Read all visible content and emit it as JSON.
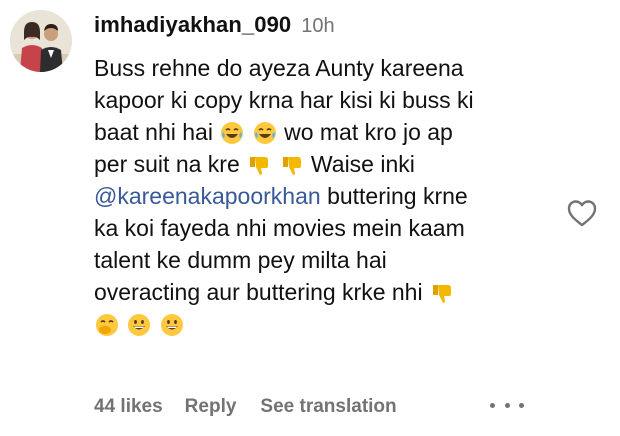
{
  "comment": {
    "username": "imhadiyakhan_090",
    "time": "10h",
    "lines": [
      "Buss rehne do ayeza Aunty kareena",
      "kapoor ki copy krna har kisi ki buss ki",
      "baat nhi hai",
      "wo mat kro jo ap",
      "per suit na kre",
      "Waise inki",
      "@kareenakapoorkhan",
      "buttering krne",
      "ka koi fayeda nhi movies mein kaam",
      "talent ke dumm pey milta hai",
      "overacting aur buttering krke nhi"
    ],
    "emojis": [
      "face-with-tears-of-joy",
      "face-with-tears-of-joy",
      "thumbs-down",
      "thumbs-down",
      "thumbs-down",
      "face-with-hand-over-mouth",
      "grinning-face",
      "grinning-face"
    ]
  },
  "footer": {
    "likes": "44 likes",
    "reply": "Reply",
    "see_translation": "See translation"
  },
  "colors": {
    "text": "#111111",
    "muted": "#737373",
    "mention": "#385898",
    "emoji_yellow": "#FFC83D",
    "thumb_yellow": "#F5B800"
  }
}
